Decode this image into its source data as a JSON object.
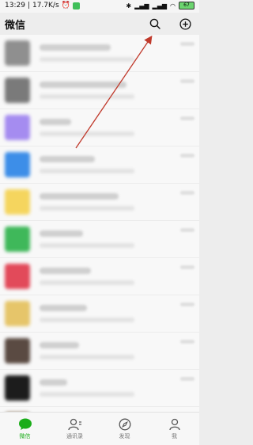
{
  "status_bar": {
    "time": "13:29",
    "network_speed": "17.7K/s",
    "battery": "67"
  },
  "header": {
    "title": "微信"
  },
  "chat_list": {
    "rows": [
      {
        "avatar_color": "#8f8f8f",
        "name_width": 90
      },
      {
        "avatar_color": "#7a7a7a",
        "name_width": 110
      },
      {
        "avatar_color": "#a58cf0",
        "name_width": 40
      },
      {
        "avatar_color": "#3d8ee8",
        "name_width": 70
      },
      {
        "avatar_color": "#f5d55e",
        "name_width": 100
      },
      {
        "avatar_color": "#3fb85a",
        "name_width": 55
      },
      {
        "avatar_color": "#e24a5a",
        "name_width": 65
      },
      {
        "avatar_color": "#e6c56a",
        "name_width": 60
      },
      {
        "avatar_color": "#5a4a42",
        "name_width": 50
      },
      {
        "avatar_color": "#1c1c1c",
        "name_width": 35
      },
      {
        "avatar_color": "#6a4a2a",
        "name_width": 80
      }
    ]
  },
  "tabbar": {
    "tabs": [
      {
        "label": "微信",
        "icon": "chat-icon",
        "active": true
      },
      {
        "label": "通讯录",
        "icon": "contacts-icon",
        "active": false
      },
      {
        "label": "发现",
        "icon": "compass-icon",
        "active": false
      },
      {
        "label": "我",
        "icon": "person-icon",
        "active": false
      }
    ]
  },
  "colors": {
    "accent": "#1aad19",
    "arrow": "#c0392b"
  }
}
